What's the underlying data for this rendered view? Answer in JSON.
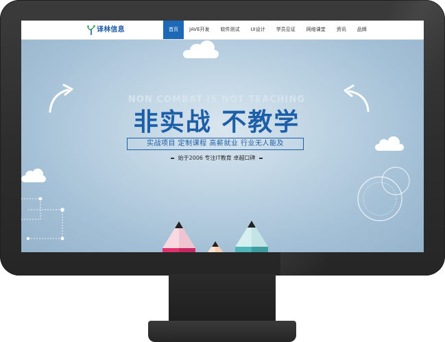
{
  "nav": {
    "logo_text": "译林信息",
    "items": [
      {
        "label": "首页",
        "active": true
      },
      {
        "label": "JAVE开发",
        "active": false
      },
      {
        "label": "软件测试",
        "active": false
      },
      {
        "label": "UI设计",
        "active": false
      },
      {
        "label": "学员见证",
        "active": false
      },
      {
        "label": "网络课堂",
        "active": false
      },
      {
        "label": "资讯",
        "active": false
      },
      {
        "label": "品牌",
        "active": false
      }
    ],
    "active_color": "#1e68b8"
  },
  "hero": {
    "tagline_en": "NON COMBAT IS NOT TEACHING",
    "title": "非实战 不教学",
    "subtitle": "实战项目  定制课程  高薪就业  行业无人能及",
    "since": "始于2006  专注IT教育  卓越口碑",
    "accent_color": "#1d5ea8",
    "pencil_colors": [
      "#e0326d",
      "#f29a3c",
      "#4fb5b8"
    ]
  }
}
